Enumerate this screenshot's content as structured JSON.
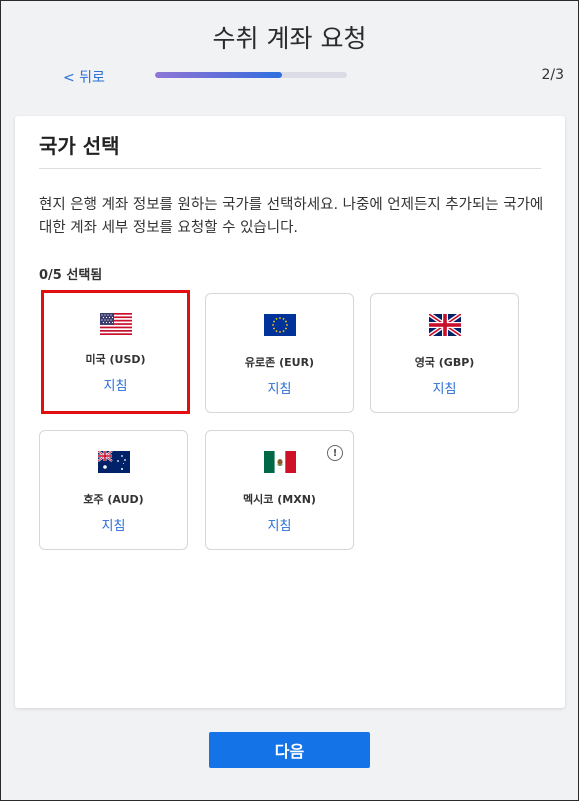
{
  "header": {
    "title": "수취 계좌 요청",
    "back_label": "< 뒤로",
    "step": "2/3",
    "progress": 0.66
  },
  "main": {
    "section_title": "국가 선택",
    "description": "현지 은행 계좌 정보를 원하는 국가를 선택하세요. 나중에 언제든지 추가되는 국가에 대한 계좌 세부 정보를 요청할 수 있습니다.",
    "selected_count": "0/5 선택됨",
    "countries": [
      {
        "name": "미국 (USD)",
        "guide": "지침",
        "flag": "us-flag",
        "highlighted": true
      },
      {
        "name": "유로존 (EUR)",
        "guide": "지침",
        "flag": "eu-flag",
        "highlighted": false
      },
      {
        "name": "영국 (GBP)",
        "guide": "지침",
        "flag": "uk-flag",
        "highlighted": false
      },
      {
        "name": "호주 (AUD)",
        "guide": "지침",
        "flag": "au-flag",
        "highlighted": false
      },
      {
        "name": "멕시코 (MXN)",
        "guide": "지침",
        "flag": "mx-flag",
        "highlighted": false,
        "warning": "!"
      }
    ]
  },
  "footer": {
    "next_label": "다음"
  },
  "colors": {
    "accent": "#1473e6",
    "link": "#2a6fd6",
    "highlight": "#e01010"
  }
}
